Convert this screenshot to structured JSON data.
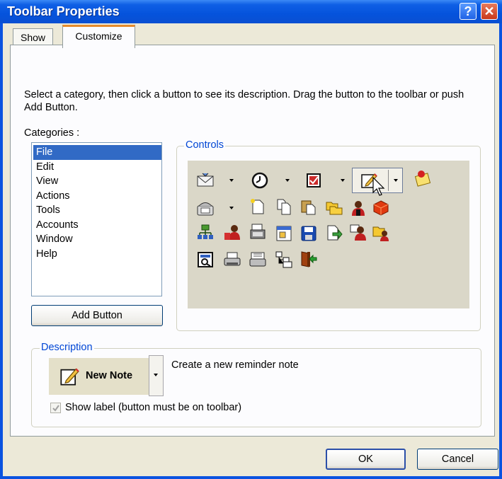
{
  "window": {
    "title": "Toolbar Properties"
  },
  "titlebar_buttons": {
    "help": "?",
    "close": "✕"
  },
  "tabs": [
    {
      "label": "Show"
    },
    {
      "label": "Customize"
    }
  ],
  "instructions": "Select a category, then click a button to see its description. Drag the button to the toolbar or push Add Button.",
  "categories": {
    "label": "Categories :",
    "items": [
      "File",
      "Edit",
      "View",
      "Actions",
      "Tools",
      "Accounts",
      "Window",
      "Help"
    ],
    "selected": "File"
  },
  "add_button": "Add Button",
  "controls": {
    "label": "Controls",
    "icons": [
      "new-mail-icon",
      "reminder-clock-icon",
      "new-task-icon",
      "new-note-icon",
      "contact-card-icon",
      "phone-icon",
      "new-document-icon",
      "copy-document-icon",
      "paste-document-icon",
      "folders-icon",
      "user-icon",
      "package-icon",
      "org-chart-icon",
      "contacts-icon",
      "print-fax-icon",
      "properties-window-icon",
      "save-disk-icon",
      "export-document-icon",
      "user-folder-icon",
      "shared-folder-icon",
      "preview-icon",
      "print-icon",
      "print-preview-icon",
      "tree-view-icon",
      "exit-door-icon"
    ]
  },
  "description": {
    "label": "Description",
    "button_label": "New Note",
    "text": "Create a new reminder note",
    "show_label_checkbox": "Show label (button must be on toolbar)",
    "show_label_checked": true
  },
  "footer": {
    "ok": "OK",
    "cancel": "Cancel"
  }
}
